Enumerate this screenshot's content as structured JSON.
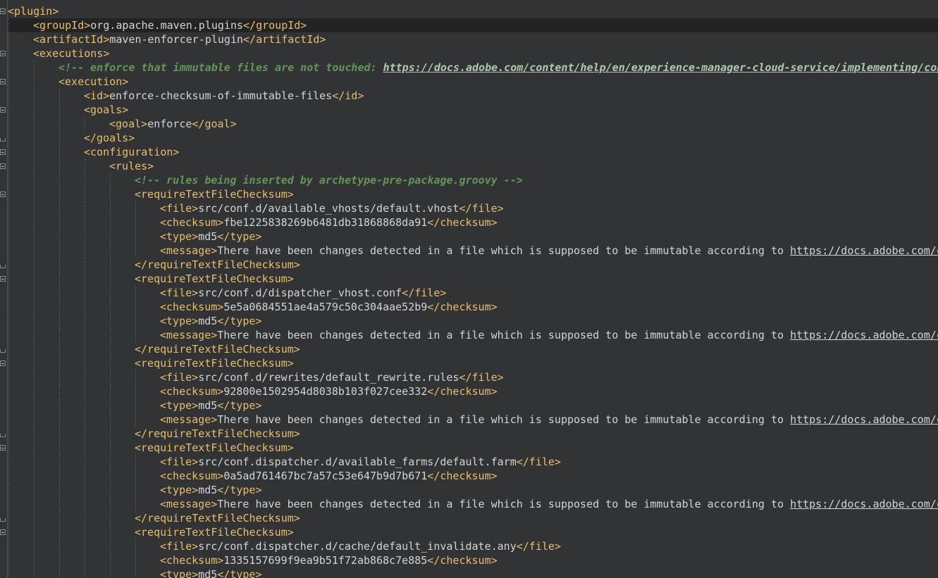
{
  "colors": {
    "background": "#313335",
    "current_line": "#232323",
    "tag": "#e8bf6a",
    "text": "#d4d4d4",
    "comment": "#629755",
    "indent_guide": "#595959",
    "gutter_border": "#555555"
  },
  "lines": [
    {
      "indent": 0,
      "current": false,
      "fold": "open",
      "parts": [
        {
          "t": "tag",
          "v": "<plugin>"
        }
      ]
    },
    {
      "indent": 1,
      "current": true,
      "fold": "",
      "parts": [
        {
          "t": "tag",
          "v": "<groupId>"
        },
        {
          "t": "text",
          "v": "org.apache.maven.plugins"
        },
        {
          "t": "tag",
          "v": "</groupId>"
        }
      ]
    },
    {
      "indent": 1,
      "current": false,
      "fold": "",
      "parts": [
        {
          "t": "tag",
          "v": "<artifactId>"
        },
        {
          "t": "text",
          "v": "maven-enforcer-plugin"
        },
        {
          "t": "tag",
          "v": "</artifactId>"
        }
      ]
    },
    {
      "indent": 1,
      "current": false,
      "fold": "open",
      "parts": [
        {
          "t": "tag",
          "v": "<executions>"
        }
      ]
    },
    {
      "indent": 2,
      "current": false,
      "fold": "",
      "parts": [
        {
          "t": "comment",
          "v": "<!-- enforce that immutable files are not touched: "
        },
        {
          "t": "link",
          "v": "https://docs.adobe.com/content/help/en/experience-manager-cloud-service/implementing/content-delivery/disp-overview.html#file-structure"
        }
      ]
    },
    {
      "indent": 2,
      "current": false,
      "fold": "open",
      "parts": [
        {
          "t": "tag",
          "v": "<execution>"
        }
      ]
    },
    {
      "indent": 3,
      "current": false,
      "fold": "",
      "parts": [
        {
          "t": "tag",
          "v": "<id>"
        },
        {
          "t": "text",
          "v": "enforce-checksum-of-immutable-files"
        },
        {
          "t": "tag",
          "v": "</id>"
        }
      ]
    },
    {
      "indent": 3,
      "current": false,
      "fold": "open",
      "parts": [
        {
          "t": "tag",
          "v": "<goals>"
        }
      ]
    },
    {
      "indent": 4,
      "current": false,
      "fold": "",
      "parts": [
        {
          "t": "tag",
          "v": "<goal>"
        },
        {
          "t": "text",
          "v": "enforce"
        },
        {
          "t": "tag",
          "v": "</goal>"
        }
      ]
    },
    {
      "indent": 3,
      "current": false,
      "fold": "close",
      "parts": [
        {
          "t": "tag",
          "v": "</goals>"
        }
      ]
    },
    {
      "indent": 3,
      "current": false,
      "fold": "open",
      "parts": [
        {
          "t": "tag",
          "v": "<configuration>"
        }
      ]
    },
    {
      "indent": 4,
      "current": false,
      "fold": "open",
      "parts": [
        {
          "t": "tag",
          "v": "<rules>"
        }
      ]
    },
    {
      "indent": 5,
      "current": false,
      "fold": "",
      "parts": [
        {
          "t": "comment",
          "v": "<!-- rules being inserted by archetype-pre-package.groovy -->"
        }
      ]
    },
    {
      "indent": 5,
      "current": false,
      "fold": "open",
      "parts": [
        {
          "t": "tag",
          "v": "<requireTextFileChecksum>"
        }
      ]
    },
    {
      "indent": 6,
      "current": false,
      "fold": "",
      "parts": [
        {
          "t": "tag",
          "v": "<file>"
        },
        {
          "t": "text",
          "v": "src/conf.d/available_vhosts/default.vhost"
        },
        {
          "t": "tag",
          "v": "</file>"
        }
      ]
    },
    {
      "indent": 6,
      "current": false,
      "fold": "",
      "parts": [
        {
          "t": "tag",
          "v": "<checksum>"
        },
        {
          "t": "text",
          "v": "fbe1225838269b6481db31868868da91"
        },
        {
          "t": "tag",
          "v": "</checksum>"
        }
      ]
    },
    {
      "indent": 6,
      "current": false,
      "fold": "",
      "parts": [
        {
          "t": "tag",
          "v": "<type>"
        },
        {
          "t": "text",
          "v": "md5"
        },
        {
          "t": "tag",
          "v": "</type>"
        }
      ]
    },
    {
      "indent": 6,
      "current": false,
      "fold": "",
      "parts": [
        {
          "t": "tag",
          "v": "<message>"
        },
        {
          "t": "text",
          "v": "There have been changes detected in a file which is supposed to be immutable according to "
        },
        {
          "t": "plink",
          "v": "https://docs.adobe.com/content/help/en/experience-manager-cloud-service/implementing/content-delivery/disp-overview.html#file-structure"
        }
      ]
    },
    {
      "indent": 5,
      "current": false,
      "fold": "close",
      "parts": [
        {
          "t": "tag",
          "v": "</requireTextFileChecksum>"
        }
      ]
    },
    {
      "indent": 5,
      "current": false,
      "fold": "open",
      "parts": [
        {
          "t": "tag",
          "v": "<requireTextFileChecksum>"
        }
      ]
    },
    {
      "indent": 6,
      "current": false,
      "fold": "",
      "parts": [
        {
          "t": "tag",
          "v": "<file>"
        },
        {
          "t": "text",
          "v": "src/conf.d/dispatcher_vhost.conf"
        },
        {
          "t": "tag",
          "v": "</file>"
        }
      ]
    },
    {
      "indent": 6,
      "current": false,
      "fold": "",
      "parts": [
        {
          "t": "tag",
          "v": "<checksum>"
        },
        {
          "t": "text",
          "v": "5e5a0684551ae4a579c50c304aae52b9"
        },
        {
          "t": "tag",
          "v": "</checksum>"
        }
      ]
    },
    {
      "indent": 6,
      "current": false,
      "fold": "",
      "parts": [
        {
          "t": "tag",
          "v": "<type>"
        },
        {
          "t": "text",
          "v": "md5"
        },
        {
          "t": "tag",
          "v": "</type>"
        }
      ]
    },
    {
      "indent": 6,
      "current": false,
      "fold": "",
      "parts": [
        {
          "t": "tag",
          "v": "<message>"
        },
        {
          "t": "text",
          "v": "There have been changes detected in a file which is supposed to be immutable according to "
        },
        {
          "t": "plink",
          "v": "https://docs.adobe.com/content/help/en/experience-manager-cloud-service/implementing/content-delivery/disp-overview.html#file-structure"
        }
      ]
    },
    {
      "indent": 5,
      "current": false,
      "fold": "close",
      "parts": [
        {
          "t": "tag",
          "v": "</requireTextFileChecksum>"
        }
      ]
    },
    {
      "indent": 5,
      "current": false,
      "fold": "open",
      "parts": [
        {
          "t": "tag",
          "v": "<requireTextFileChecksum>"
        }
      ]
    },
    {
      "indent": 6,
      "current": false,
      "fold": "",
      "parts": [
        {
          "t": "tag",
          "v": "<file>"
        },
        {
          "t": "text",
          "v": "src/conf.d/rewrites/default_rewrite.rules"
        },
        {
          "t": "tag",
          "v": "</file>"
        }
      ]
    },
    {
      "indent": 6,
      "current": false,
      "fold": "",
      "parts": [
        {
          "t": "tag",
          "v": "<checksum>"
        },
        {
          "t": "text",
          "v": "92800e1502954d8038b103f027cee332"
        },
        {
          "t": "tag",
          "v": "</checksum>"
        }
      ]
    },
    {
      "indent": 6,
      "current": false,
      "fold": "",
      "parts": [
        {
          "t": "tag",
          "v": "<type>"
        },
        {
          "t": "text",
          "v": "md5"
        },
        {
          "t": "tag",
          "v": "</type>"
        }
      ]
    },
    {
      "indent": 6,
      "current": false,
      "fold": "",
      "parts": [
        {
          "t": "tag",
          "v": "<message>"
        },
        {
          "t": "text",
          "v": "There have been changes detected in a file which is supposed to be immutable according to "
        },
        {
          "t": "plink",
          "v": "https://docs.adobe.com/content/help/en/experience-manager-cloud-service/implementing/content-delivery/disp-overview.html#file-structure"
        }
      ]
    },
    {
      "indent": 5,
      "current": false,
      "fold": "close",
      "parts": [
        {
          "t": "tag",
          "v": "</requireTextFileChecksum>"
        }
      ]
    },
    {
      "indent": 5,
      "current": false,
      "fold": "open",
      "parts": [
        {
          "t": "tag",
          "v": "<requireTextFileChecksum>"
        }
      ]
    },
    {
      "indent": 6,
      "current": false,
      "fold": "",
      "parts": [
        {
          "t": "tag",
          "v": "<file>"
        },
        {
          "t": "text",
          "v": "src/conf.dispatcher.d/available_farms/default.farm"
        },
        {
          "t": "tag",
          "v": "</file>"
        }
      ]
    },
    {
      "indent": 6,
      "current": false,
      "fold": "",
      "parts": [
        {
          "t": "tag",
          "v": "<checksum>"
        },
        {
          "t": "text",
          "v": "0a5ad761467bc7a57c53e647b9d7b671"
        },
        {
          "t": "tag",
          "v": "</checksum>"
        }
      ]
    },
    {
      "indent": 6,
      "current": false,
      "fold": "",
      "parts": [
        {
          "t": "tag",
          "v": "<type>"
        },
        {
          "t": "text",
          "v": "md5"
        },
        {
          "t": "tag",
          "v": "</type>"
        }
      ]
    },
    {
      "indent": 6,
      "current": false,
      "fold": "",
      "parts": [
        {
          "t": "tag",
          "v": "<message>"
        },
        {
          "t": "text",
          "v": "There have been changes detected in a file which is supposed to be immutable according to "
        },
        {
          "t": "plink",
          "v": "https://docs.adobe.com/content/help/en/experience-manager-cloud-service/implementing/content-delivery/disp-overview.html#file-structure"
        }
      ]
    },
    {
      "indent": 5,
      "current": false,
      "fold": "close",
      "parts": [
        {
          "t": "tag",
          "v": "</requireTextFileChecksum>"
        }
      ]
    },
    {
      "indent": 5,
      "current": false,
      "fold": "open",
      "parts": [
        {
          "t": "tag",
          "v": "<requireTextFileChecksum>"
        }
      ]
    },
    {
      "indent": 6,
      "current": false,
      "fold": "",
      "parts": [
        {
          "t": "tag",
          "v": "<file>"
        },
        {
          "t": "text",
          "v": "src/conf.dispatcher.d/cache/default_invalidate.any"
        },
        {
          "t": "tag",
          "v": "</file>"
        }
      ]
    },
    {
      "indent": 6,
      "current": false,
      "fold": "",
      "parts": [
        {
          "t": "tag",
          "v": "<checksum>"
        },
        {
          "t": "text",
          "v": "1335157699f9ea9b51f72ab868c7e885"
        },
        {
          "t": "tag",
          "v": "</checksum>"
        }
      ]
    },
    {
      "indent": 6,
      "current": false,
      "fold": "",
      "parts": [
        {
          "t": "tag",
          "v": "<type>"
        },
        {
          "t": "text",
          "v": "md5"
        },
        {
          "t": "tag",
          "v": "</type>"
        }
      ]
    }
  ]
}
